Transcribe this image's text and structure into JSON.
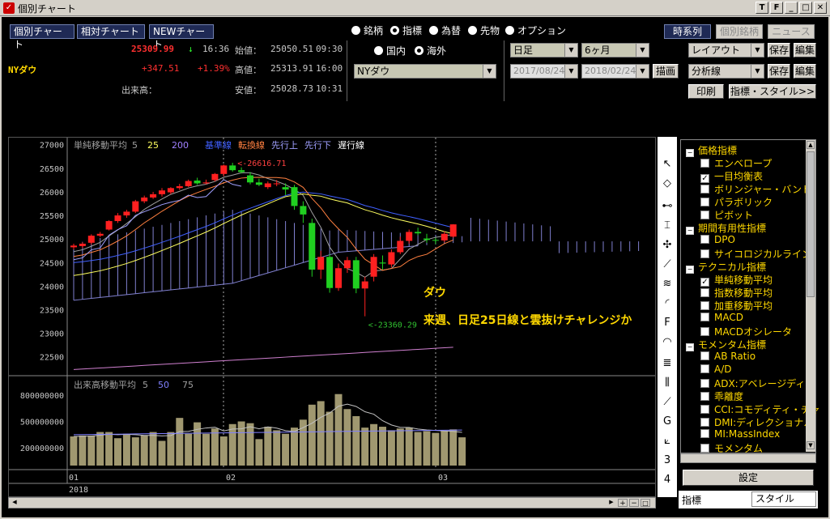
{
  "window": {
    "title": "個別チャート",
    "btn_t": "T",
    "btn_f": "F",
    "btn_min": "_",
    "btn_max": "□",
    "btn_close": "✕"
  },
  "nav": {
    "single": "個別チャート",
    "relative": "相対チャート",
    "new": "NEWチャート"
  },
  "quote": {
    "name": "NYダウ",
    "last": "25309.99",
    "arrow": "↓",
    "time": "16:36",
    "change": "+347.51",
    "change_pct": "+1.39%",
    "open_label": "始値：",
    "open": "25050.51",
    "open_time": "09:30",
    "high_label": "高値：",
    "high": "25313.91",
    "high_time": "16:00",
    "low_label": "安値：",
    "low": "25028.73",
    "low_time": "10:31",
    "volume_label": "出来高："
  },
  "mode_radios": [
    {
      "label": "銘柄",
      "selected": false
    },
    {
      "label": "指標",
      "selected": true
    },
    {
      "label": "為替",
      "selected": false
    },
    {
      "label": "先物",
      "selected": false
    },
    {
      "label": "オプション",
      "selected": false
    }
  ],
  "region_radios": [
    {
      "label": "国内",
      "selected": false
    },
    {
      "label": "海外",
      "selected": true
    }
  ],
  "symbol_select": "NYダウ",
  "period": {
    "bar": "日足",
    "range": "6ヶ月",
    "from": "2017/08/24",
    "to": "2018/02/24",
    "draw": "描画"
  },
  "right_tabs": {
    "timeseries": "時系列",
    "stockinfo": "個別銘柄",
    "news": "ニュース"
  },
  "layout": {
    "label": "レイアウト",
    "save": "保存",
    "edit": "編集"
  },
  "analysis": {
    "label": "分析線",
    "save": "保存",
    "edit": "編集"
  },
  "print": "印刷",
  "indicator_style": "指標・スタイル>>",
  "chart": {
    "legend_main": [
      {
        "text": "単純移動平均",
        "color": "#a0a0a0"
      },
      {
        "text": "5",
        "color": "#a0a0a0"
      },
      {
        "text": "25",
        "color": "#ffff60"
      },
      {
        "text": "200",
        "color": "#a080ff"
      },
      {
        "text": "基準線",
        "color": "#4060ff"
      },
      {
        "text": "転換線",
        "color": "#ff8040"
      },
      {
        "text": "先行上",
        "color": "#a0a0ff"
      },
      {
        "text": "先行下",
        "color": "#a0a0ff"
      },
      {
        "text": "遅行線",
        "color": "#ffffff"
      }
    ],
    "legend_vol": [
      {
        "text": "出来高移動平均",
        "color": "#a0a0a0"
      },
      {
        "text": "5",
        "color": "#a0a0a0"
      },
      {
        "text": "50",
        "color": "#8080ff"
      },
      {
        "text": "75",
        "color": "#a0a0a0"
      }
    ],
    "annot_high": "26616.71",
    "annot_low": "23360.29",
    "comment_title": "ダウ",
    "comment_body": "来週、日足25日線と雲抜けチャレンジか",
    "x_labels": [
      "01",
      "02",
      "03"
    ],
    "year_label": "2018"
  },
  "chart_data": {
    "type": "candlestick",
    "price_ticks": [
      27000,
      26500,
      26000,
      25500,
      25000,
      24500,
      24000,
      23500,
      23000,
      22500
    ],
    "price_ylim": [
      22100,
      27150
    ],
    "volume_ticks": [
      "800000000",
      "500000000",
      "200000000"
    ],
    "volume_ylim": [
      0,
      1000000000
    ],
    "candles": [
      {
        "o": 24824,
        "h": 24900,
        "l": 24780,
        "c": 24860
      },
      {
        "o": 24850,
        "h": 24930,
        "l": 24810,
        "c": 24900
      },
      {
        "o": 24920,
        "h": 25100,
        "l": 24880,
        "c": 25070
      },
      {
        "o": 25070,
        "h": 25150,
        "l": 25040,
        "c": 25110
      },
      {
        "o": 25200,
        "h": 25400,
        "l": 25180,
        "c": 25380
      },
      {
        "o": 25380,
        "h": 25550,
        "l": 25340,
        "c": 25500
      },
      {
        "o": 25500,
        "h": 25620,
        "l": 25450,
        "c": 25580
      },
      {
        "o": 25580,
        "h": 25830,
        "l": 25550,
        "c": 25800
      },
      {
        "o": 25800,
        "h": 25920,
        "l": 25760,
        "c": 25880
      },
      {
        "o": 25880,
        "h": 26000,
        "l": 25850,
        "c": 25950
      },
      {
        "o": 25950,
        "h": 26080,
        "l": 25900,
        "c": 26030
      },
      {
        "o": 25990,
        "h": 26100,
        "l": 25950,
        "c": 26080
      },
      {
        "o": 26080,
        "h": 26170,
        "l": 26040,
        "c": 26120
      },
      {
        "o": 26120,
        "h": 26260,
        "l": 26100,
        "c": 26230
      },
      {
        "o": 26240,
        "h": 26300,
        "l": 26150,
        "c": 26180
      },
      {
        "o": 26180,
        "h": 26260,
        "l": 26160,
        "c": 26200
      },
      {
        "o": 26250,
        "h": 26400,
        "l": 26220,
        "c": 26380
      },
      {
        "o": 26380,
        "h": 26580,
        "l": 26330,
        "c": 26560
      },
      {
        "o": 26560,
        "h": 26617,
        "l": 26430,
        "c": 26460
      },
      {
        "o": 26460,
        "h": 26520,
        "l": 26390,
        "c": 26420
      },
      {
        "o": 26350,
        "h": 26420,
        "l": 26160,
        "c": 26200
      },
      {
        "o": 26200,
        "h": 26280,
        "l": 26120,
        "c": 26150
      },
      {
        "o": 26100,
        "h": 26220,
        "l": 26060,
        "c": 26180
      },
      {
        "o": 26180,
        "h": 26250,
        "l": 26120,
        "c": 26180
      },
      {
        "o": 26100,
        "h": 26180,
        "l": 25930,
        "c": 26050
      },
      {
        "o": 26100,
        "h": 26150,
        "l": 25620,
        "c": 25700
      },
      {
        "o": 25700,
        "h": 25800,
        "l": 25340,
        "c": 25520
      },
      {
        "o": 25340,
        "h": 25430,
        "l": 24200,
        "c": 24350
      },
      {
        "o": 24350,
        "h": 24750,
        "l": 24150,
        "c": 24620
      },
      {
        "o": 24620,
        "h": 24680,
        "l": 23860,
        "c": 23960
      },
      {
        "o": 23960,
        "h": 24480,
        "l": 23900,
        "c": 24380
      },
      {
        "o": 24380,
        "h": 24620,
        "l": 24280,
        "c": 24550
      },
      {
        "o": 24550,
        "h": 24620,
        "l": 23850,
        "c": 23950
      },
      {
        "o": 23950,
        "h": 24200,
        "l": 23360,
        "c": 24100
      },
      {
        "o": 24200,
        "h": 24680,
        "l": 24100,
        "c": 24620
      },
      {
        "o": 24500,
        "h": 24650,
        "l": 24350,
        "c": 24480
      },
      {
        "o": 24460,
        "h": 24780,
        "l": 24400,
        "c": 24720
      },
      {
        "o": 24720,
        "h": 25050,
        "l": 24680,
        "c": 24960
      },
      {
        "o": 24960,
        "h": 25200,
        "l": 24900,
        "c": 25150
      },
      {
        "o": 25150,
        "h": 25240,
        "l": 25080,
        "c": 25120
      },
      {
        "o": 25010,
        "h": 25110,
        "l": 24920,
        "c": 24980
      },
      {
        "o": 24980,
        "h": 25030,
        "l": 24890,
        "c": 24970
      },
      {
        "o": 24970,
        "h": 25160,
        "l": 24930,
        "c": 25110
      },
      {
        "o": 25050,
        "h": 25314,
        "l": 25029,
        "c": 25310
      }
    ],
    "volumes": [
      330000000,
      340000000,
      340000000,
      380000000,
      380000000,
      310000000,
      360000000,
      320000000,
      340000000,
      380000000,
      280000000,
      380000000,
      540000000,
      360000000,
      490000000,
      360000000,
      420000000,
      330000000,
      470000000,
      500000000,
      480000000,
      300000000,
      440000000,
      400000000,
      360000000,
      430000000,
      520000000,
      690000000,
      730000000,
      610000000,
      810000000,
      640000000,
      560000000,
      430000000,
      470000000,
      440000000,
      400000000,
      420000000,
      430000000,
      380000000,
      390000000,
      370000000,
      390000000,
      410000000,
      320000000
    ]
  },
  "tree": [
    {
      "type": "cat",
      "label": "価格指標"
    },
    {
      "type": "item",
      "label": "エンベロープ",
      "checked": false
    },
    {
      "type": "item",
      "label": "一目均衡表",
      "checked": true
    },
    {
      "type": "item",
      "label": "ボリンジャー・バンド",
      "checked": false
    },
    {
      "type": "item",
      "label": "パラボリック",
      "checked": false
    },
    {
      "type": "item",
      "label": "ピボット",
      "checked": false
    },
    {
      "type": "cat",
      "label": "期間有用性指標"
    },
    {
      "type": "item",
      "label": "DPO",
      "checked": false
    },
    {
      "type": "item",
      "label": "サイコロジカルライン",
      "checked": false
    },
    {
      "type": "cat",
      "label": "テクニカル指標"
    },
    {
      "type": "item",
      "label": "単純移動平均",
      "checked": true
    },
    {
      "type": "item",
      "label": "指数移動平均",
      "checked": false
    },
    {
      "type": "item",
      "label": "加重移動平均",
      "checked": false
    },
    {
      "type": "item",
      "label": "MACD",
      "checked": false
    },
    {
      "type": "item",
      "label": "MACDオシレータ",
      "checked": false
    },
    {
      "type": "cat",
      "label": "モメンタム指標"
    },
    {
      "type": "item",
      "label": "AB Ratio",
      "checked": false
    },
    {
      "type": "item",
      "label": "A/D",
      "checked": false
    },
    {
      "type": "item",
      "label": "ADX:アベレージディレ",
      "checked": false
    },
    {
      "type": "item",
      "label": "乖離度",
      "checked": false
    },
    {
      "type": "item",
      "label": "CCI:コモディティ・チャ",
      "checked": false
    },
    {
      "type": "item",
      "label": "DMI:ディレクショナル",
      "checked": false
    },
    {
      "type": "item",
      "label": "MI:MassIndex",
      "checked": false
    },
    {
      "type": "item",
      "label": "モメンタム",
      "checked": false
    }
  ],
  "settings_btn": "設定",
  "bottom_tabs": {
    "indicator": "指標",
    "style": "スタイル"
  },
  "colors": {
    "up": "#ff2020",
    "down": "#20d020",
    "bg": "#000000",
    "accent": "#ffd800"
  }
}
